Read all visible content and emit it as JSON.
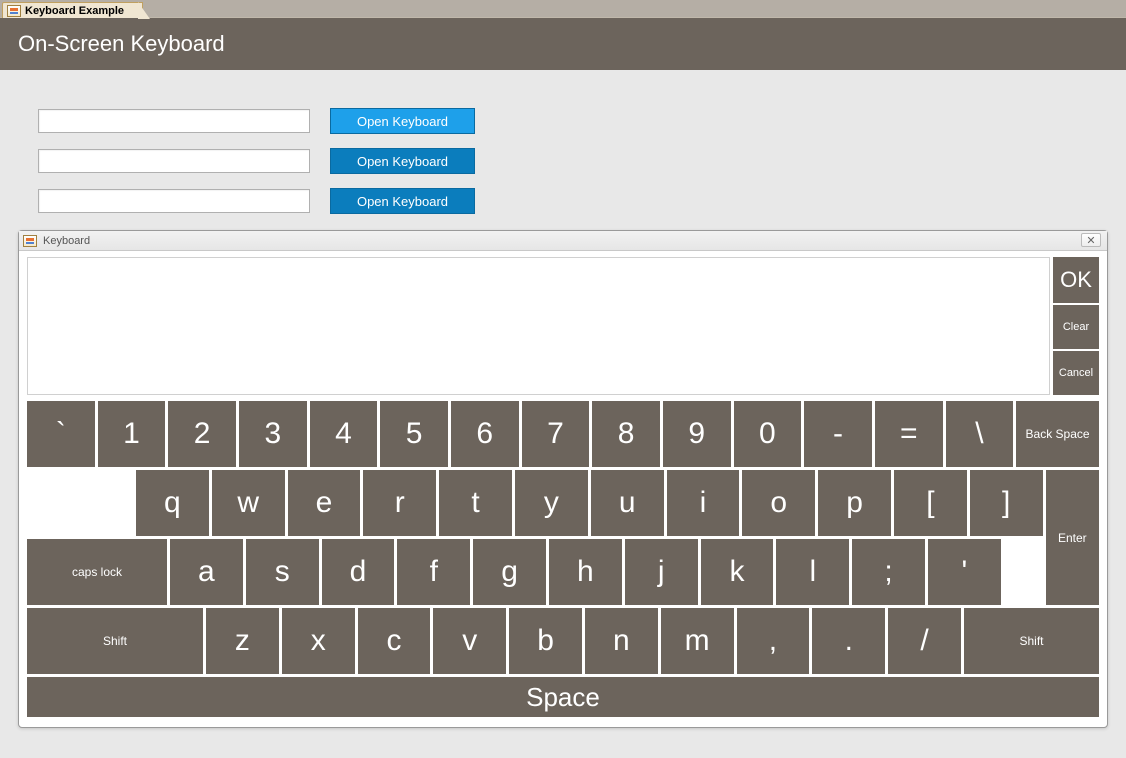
{
  "tab": {
    "label": "Keyboard Example"
  },
  "header": {
    "title": "On-Screen Keyboard"
  },
  "form": {
    "rows": [
      {
        "value": "",
        "button": "Open Keyboard",
        "style": "light"
      },
      {
        "value": "",
        "button": "Open Keyboard",
        "style": "dark"
      },
      {
        "value": "",
        "button": "Open Keyboard",
        "style": "dark"
      }
    ]
  },
  "keyboard": {
    "title": "Keyboard",
    "close_glyph": "✕",
    "display_value": "",
    "side": {
      "ok": "OK",
      "clear": "Clear",
      "cancel": "Cancel"
    },
    "row1": [
      "`",
      "1",
      "2",
      "3",
      "4",
      "5",
      "6",
      "7",
      "8",
      "9",
      "0",
      "-",
      "=",
      "\\"
    ],
    "backspace": "Back Space",
    "row2": [
      "q",
      "w",
      "e",
      "r",
      "t",
      "y",
      "u",
      "i",
      "o",
      "p",
      "[",
      "]"
    ],
    "capslock": "caps lock",
    "row3": [
      "a",
      "s",
      "d",
      "f",
      "g",
      "h",
      "j",
      "k",
      "l",
      ";",
      "'"
    ],
    "enter": "Enter",
    "shift_l": "Shift",
    "row4": [
      "z",
      "x",
      "c",
      "v",
      "b",
      "n",
      "m",
      ",",
      ".",
      "/"
    ],
    "shift_r": "Shift",
    "space": "Space"
  }
}
